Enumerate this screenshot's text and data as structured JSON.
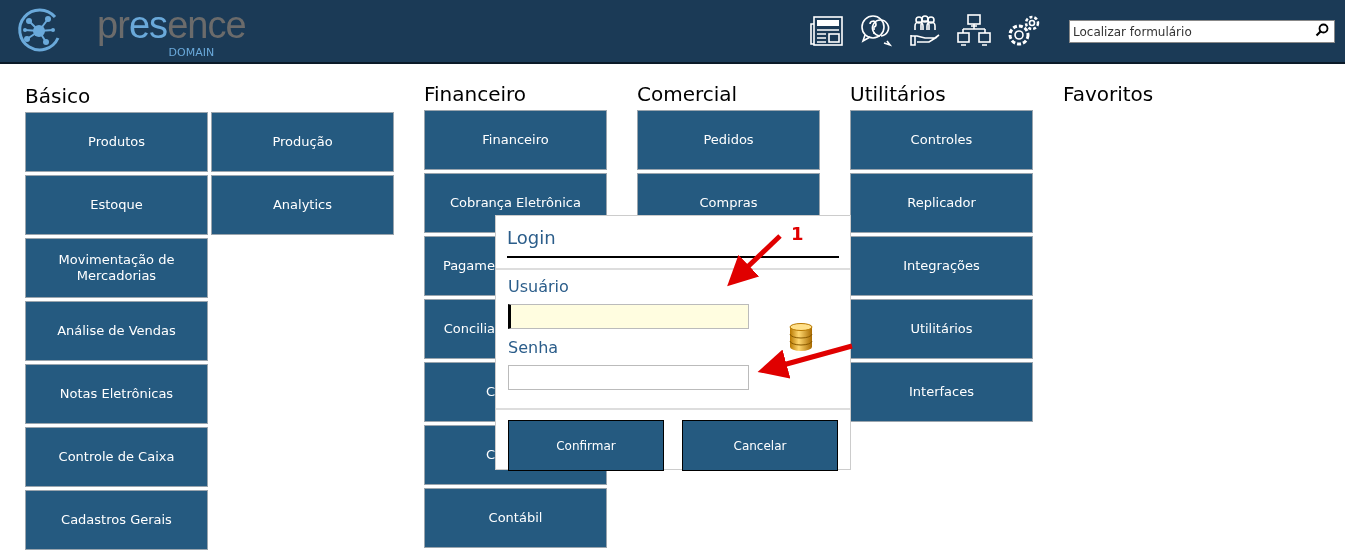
{
  "header": {
    "logo": {
      "start": "pr",
      "accent": "es",
      "end": "ence",
      "subtitle": "DOMAIN"
    },
    "toolbar": [
      {
        "kind": "news"
      },
      {
        "kind": "help"
      },
      {
        "kind": "team"
      },
      {
        "kind": "network"
      },
      {
        "kind": "settings"
      }
    ],
    "search": {
      "placeholder": "Localizar formulário"
    }
  },
  "sections": [
    {
      "title": "Básico",
      "columns": [
        [
          {
            "label": "Produtos"
          },
          {
            "label": "Estoque"
          },
          {
            "label": "Movimentação de Mercadorias"
          },
          {
            "label": "Análise de Vendas"
          },
          {
            "label": "Notas Eletrônicas"
          },
          {
            "label": "Controle de Caixa"
          },
          {
            "label": "Cadastros Gerais"
          }
        ],
        [
          {
            "label": "Produção"
          },
          {
            "label": "Analytics"
          }
        ]
      ]
    },
    {
      "title": "Financeiro",
      "columns": [
        [
          {
            "label": "Financeiro",
            "cut": false
          },
          {
            "label": "Cobrança Eletrônica",
            "cut": false
          },
          {
            "label": "Pagame",
            "cut": true
          },
          {
            "label": "Concilia",
            "cut": true
          },
          {
            "label": "C",
            "cut": true
          },
          {
            "label": "C",
            "cut": true
          },
          {
            "label": "Contábil",
            "cut": false
          }
        ]
      ]
    },
    {
      "title": "Comercial",
      "columns": [
        [
          {
            "label": "Pedidos"
          },
          {
            "label": "Compras"
          }
        ]
      ]
    },
    {
      "title": "Utilitários",
      "columns": [
        [
          {
            "label": "Controles"
          },
          {
            "label": "Replicador"
          },
          {
            "label": "Integrações"
          },
          {
            "label": "Utilitários"
          },
          {
            "label": "Interfaces"
          }
        ]
      ]
    },
    {
      "title": "Favoritos"
    }
  ],
  "dialog": {
    "title": "Login",
    "fields": [
      {
        "label": "Usuário",
        "focused": true
      },
      {
        "label": "Senha",
        "focused": false
      }
    ],
    "buttons": [
      "Confirmar",
      "Cancelar"
    ]
  },
  "annotation": {
    "label": "1"
  }
}
